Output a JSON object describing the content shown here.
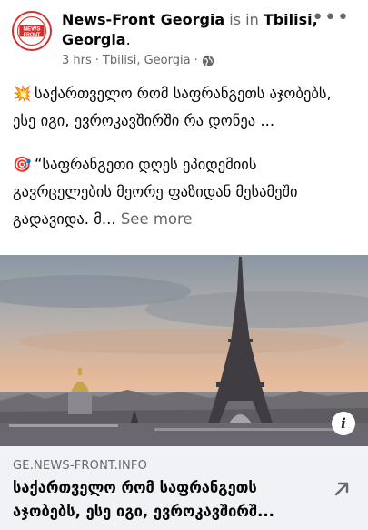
{
  "header": {
    "page_name": "News-Front Georgia",
    "is_in": " is in ",
    "place": "Tbilisi, Georgia",
    "trailing_dot": ".",
    "time": "3 hrs",
    "separator": " · ",
    "location": "Tbilisi, Georgia",
    "separator2": " · ",
    "privacy_icon": "globe-icon",
    "more_label": "•••",
    "avatar_lines": [
      "NEWS",
      "FRONT"
    ]
  },
  "post": {
    "para1_emoji": "💥",
    "para1_text": "საქართველო რომ საფრანგეთს აჯობებს, ესე იგი, ევროკავშირში რა დონეა ...",
    "para2_emoji": "🎯",
    "para2_text": "“საფრანგეთი დღეს ეპიდემიის გავრცელების მეორე ფაზიდან მესამეში გადავიდა. მ... ",
    "see_more": "See more"
  },
  "link": {
    "info_label": "i",
    "domain": "GE.NEWS-FRONT.INFO",
    "title": "საქართველო რომ საფრანგეთს აჯობებს, ესე იგი, ევროკავშირშ...",
    "share_icon": "share-arrow-icon"
  },
  "colors": {
    "brand_red": "#d32f2f",
    "secondary_text": "#65676b",
    "link_bg": "#f0f2f5"
  }
}
